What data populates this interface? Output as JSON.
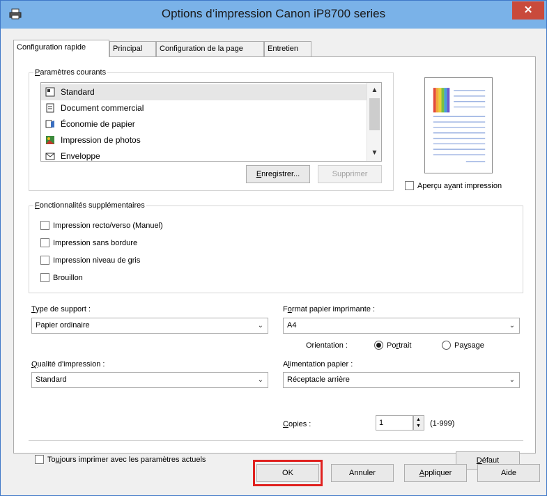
{
  "window": {
    "title": "Options d’impression Canon iP8700 series",
    "close_symbol": "✕"
  },
  "tabs": [
    {
      "label": "Configuration rapide",
      "active": true
    },
    {
      "label": "Principal",
      "active": false
    },
    {
      "label": "Configuration de la page",
      "active": false
    },
    {
      "label": "Entretien",
      "active": false
    }
  ],
  "current_settings": {
    "label_first": "P",
    "label_rest": "aramètres courants",
    "items": [
      {
        "label": "Standard",
        "icon": "standard-doc-icon",
        "selected": true
      },
      {
        "label": "Document commercial",
        "icon": "business-doc-icon",
        "selected": false
      },
      {
        "label": "Économie de papier",
        "icon": "paper-saving-icon",
        "selected": false
      },
      {
        "label": "Impression de photos",
        "icon": "photo-icon",
        "selected": false
      },
      {
        "label": "Enveloppe",
        "icon": "envelope-icon",
        "selected": false
      }
    ],
    "save_button_first": "E",
    "save_button_rest": "nregistrer...",
    "delete_button": "Supprimer"
  },
  "preview_checkbox": {
    "label_before": "Aperçu a",
    "label_underlined": "y",
    "label_after": "ant impression",
    "checked": false
  },
  "additional_features": {
    "label_first": "F",
    "label_rest": "onctionnalités supplémentaires",
    "options": [
      {
        "label": "Impression recto/verso (Manuel)",
        "checked": false
      },
      {
        "label": "Impression sans bordure",
        "checked": false
      },
      {
        "label": "Impression niveau de gris",
        "checked": false
      },
      {
        "label": "Brouillon",
        "checked": false
      }
    ]
  },
  "media_type": {
    "label_first": "T",
    "label_rest": "ype de support :",
    "value": "Papier ordinaire"
  },
  "printer_paper_size": {
    "label_before": "F",
    "label_underlined": "o",
    "label_after": "rmat papier imprimante :",
    "value": "A4"
  },
  "orientation": {
    "label": "Orientation :",
    "portrait_before": "Po",
    "portrait_underlined": "r",
    "portrait_after": "trait",
    "landscape_before": "Pa",
    "landscape_underlined": "y",
    "landscape_after": "sage",
    "selected": "Portrait"
  },
  "print_quality": {
    "label_first": "Q",
    "label_rest": "ualité d'impression :",
    "value": "Standard"
  },
  "paper_source": {
    "label_before": "A",
    "label_underlined": "l",
    "label_after": "imentation papier :",
    "value": "Réceptacle arrière"
  },
  "copies": {
    "label_first": "C",
    "label_rest": "opies :",
    "value": "1",
    "range": "(1-999)"
  },
  "always_print": {
    "label_before": "To",
    "label_underlined": "u",
    "label_after": "jours imprimer avec les paramètres actuels",
    "checked": false
  },
  "default_button": {
    "first": "D",
    "rest": "éfaut"
  },
  "footer": {
    "ok": "OK",
    "cancel": "Annuler",
    "apply_first": "A",
    "apply_rest": "ppliquer",
    "help": "Aide"
  },
  "colors": {
    "titlebar": "#7ab2e8",
    "close_button": "#c94a3b",
    "highlight": "#e0211f"
  }
}
